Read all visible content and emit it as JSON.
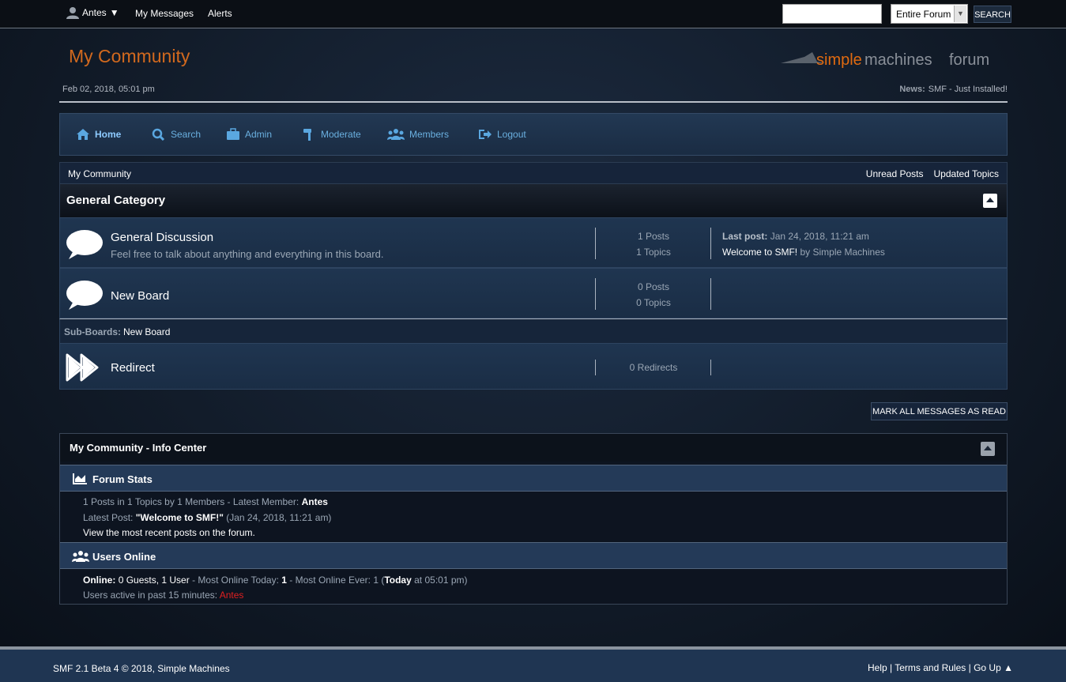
{
  "topbar": {
    "username": "Antes",
    "links": [
      "My Messages",
      "Alerts"
    ],
    "search_value": "",
    "search_scope": "Entire Forum",
    "search_button": "SEARCH"
  },
  "header": {
    "forum_title": "My Community",
    "logo_text_a": "simple",
    "logo_text_b": "machines",
    "logo_text_c": "forum",
    "date": "Feb 02, 2018, 05:01 pm",
    "news_label": "News:",
    "news_text": "SMF - Just Installed!"
  },
  "menu": [
    {
      "label": "Home",
      "icon": "home-icon"
    },
    {
      "label": "Search",
      "icon": "search-icon"
    },
    {
      "label": "Admin",
      "icon": "briefcase-icon"
    },
    {
      "label": "Moderate",
      "icon": "gavel-icon"
    },
    {
      "label": "Members",
      "icon": "users-icon"
    },
    {
      "label": "Logout",
      "icon": "logout-icon"
    }
  ],
  "navbar": {
    "breadcrumb": "My Community",
    "unread_posts": "Unread Posts",
    "updated_topics": "Updated Topics"
  },
  "category": {
    "title": "General Category",
    "boards": [
      {
        "name": "General Discussion",
        "description": "Feel free to talk about anything and everything in this board.",
        "stat1": "1 Posts",
        "stat2": "1 Topics",
        "lastpost_label": "Last post:",
        "lastpost_date": "Jan 24, 2018, 11:21 am",
        "lastpost_topic": "Welcome to SMF!",
        "lastpost_by": "by Simple Machines"
      },
      {
        "name": "New Board",
        "description": "",
        "stat1": "0 Posts",
        "stat2": "0 Topics"
      },
      {
        "name": "Redirect",
        "description": "",
        "stat1": "0 Redirects"
      }
    ],
    "subboards_label": "Sub-Boards:",
    "subboards_value": "New Board"
  },
  "mark_read_button": "MARK ALL MESSAGES AS READ",
  "info_center": {
    "title": "My Community - Info Center",
    "stats_title": "Forum Stats",
    "stats_line1_a": "1 Posts in 1 Topics by 1 Members - Latest Member:",
    "stats_line1_b": "Antes",
    "stats_line2_a": "Latest Post:",
    "stats_line2_b": "\"Welcome to SMF!\"",
    "stats_line2_c": "(Jan 24, 2018, 11:21 am)",
    "stats_line3": "View the most recent posts on the forum.",
    "online_title": "Users Online",
    "online_label": "Online:",
    "online_value": "0 Guests, 1 User",
    "most_today_label": "- Most Online Today:",
    "most_today_value": "1",
    "most_ever_label": "- Most Online Ever: 1 (",
    "most_ever_today": "Today",
    "most_ever_time": "at 05:01 pm)",
    "active_label": "Users active in past 15 minutes:",
    "active_user": "Antes"
  },
  "footer": {
    "copyright": "SMF 2.1 Beta 4 © 2018, Simple Machines",
    "help": "Help",
    "sep": "|",
    "terms": "Terms and Rules",
    "goup": "Go Up ▲"
  }
}
